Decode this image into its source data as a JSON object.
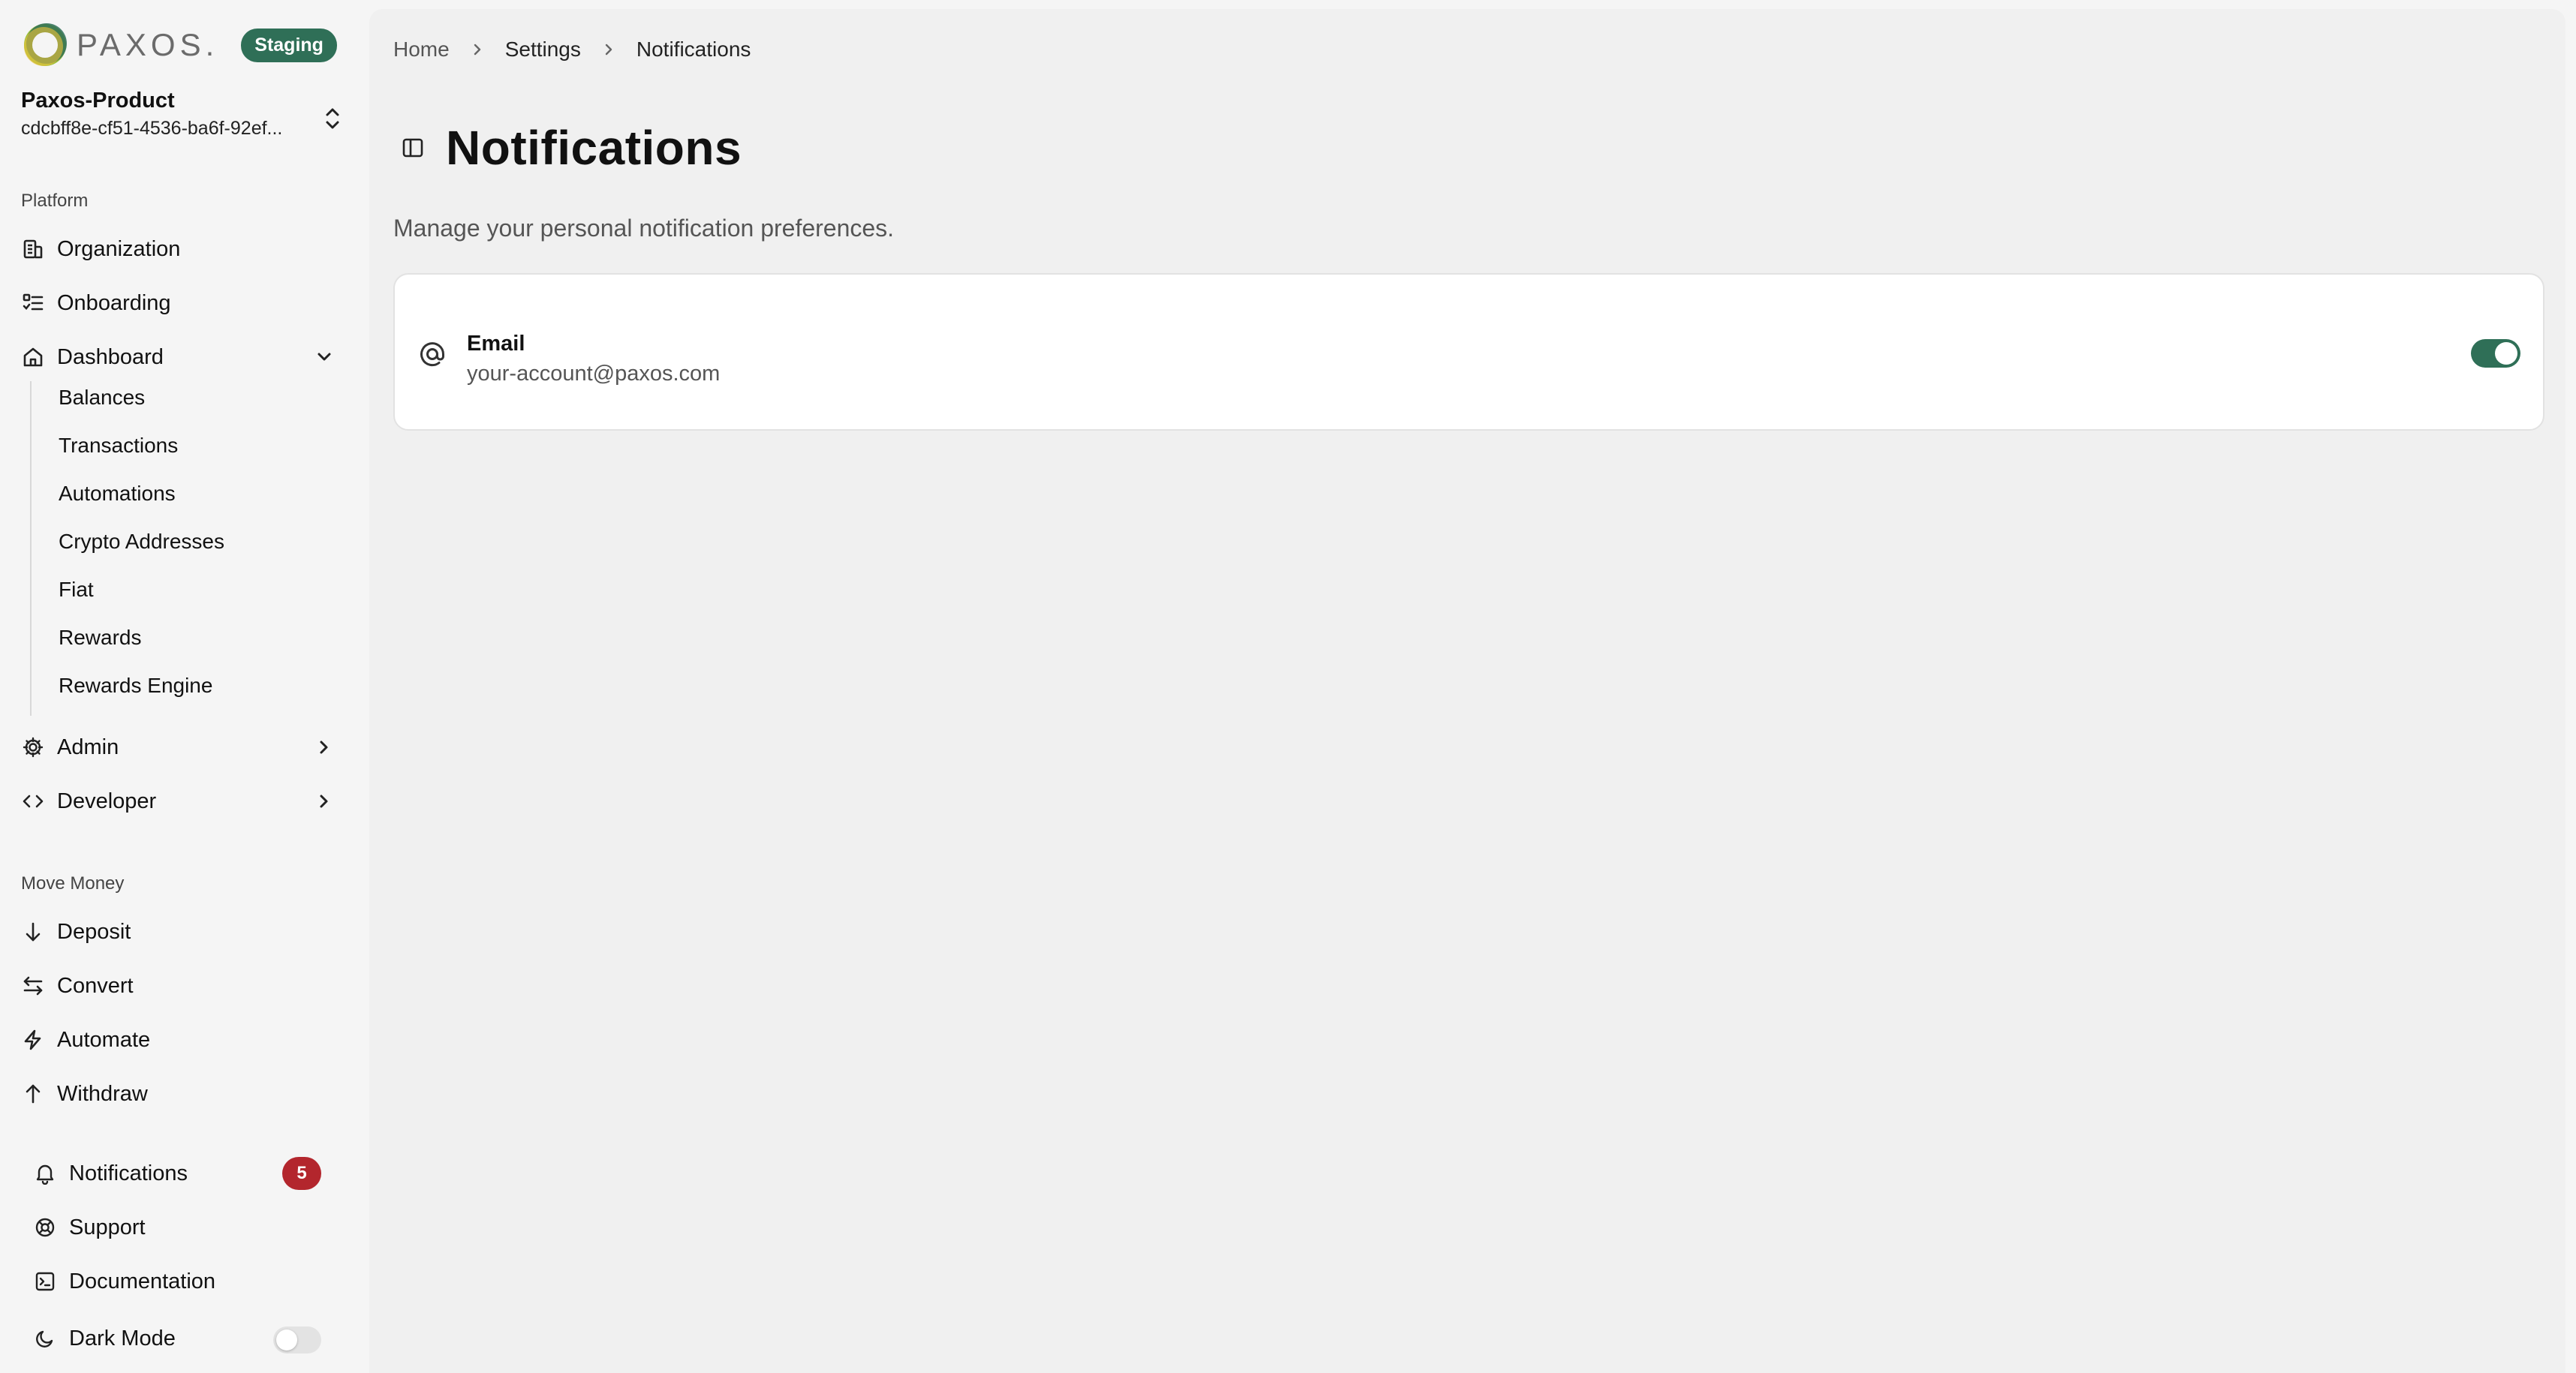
{
  "brand": {
    "name": "PAXOS.",
    "environment": "Staging"
  },
  "org": {
    "name": "Paxos-Product",
    "id": "cdcbff8e-cf51-4536-ba6f-92ef..."
  },
  "sidebar": {
    "platform_label": "Platform",
    "platform_items": [
      {
        "label": "Organization",
        "icon": "building-icon"
      },
      {
        "label": "Onboarding",
        "icon": "list-check-icon"
      },
      {
        "label": "Dashboard",
        "icon": "home-icon",
        "expanded": true
      }
    ],
    "dashboard_subitems": [
      "Balances",
      "Transactions",
      "Automations",
      "Crypto Addresses",
      "Fiat",
      "Rewards",
      "Rewards Engine"
    ],
    "admin_label": "Admin",
    "developer_label": "Developer",
    "move_money_label": "Move Money",
    "move_money_items": [
      {
        "label": "Deposit",
        "icon": "arrow-down-icon"
      },
      {
        "label": "Convert",
        "icon": "swap-arrows-icon"
      },
      {
        "label": "Automate",
        "icon": "bolt-icon"
      },
      {
        "label": "Withdraw",
        "icon": "arrow-up-icon"
      }
    ],
    "footer": {
      "notifications_label": "Notifications",
      "notifications_count": "5",
      "support_label": "Support",
      "documentation_label": "Documentation",
      "dark_mode_label": "Dark Mode",
      "dark_mode_on": false
    }
  },
  "breadcrumb": [
    "Home",
    "Settings",
    "Notifications"
  ],
  "page": {
    "title": "Notifications",
    "subtitle": "Manage your personal notification preferences."
  },
  "email_setting": {
    "label": "Email",
    "address": "your-account@paxos.com",
    "enabled": true
  },
  "colors": {
    "accent": "#2f6f57",
    "badge_red": "#b3262d"
  }
}
